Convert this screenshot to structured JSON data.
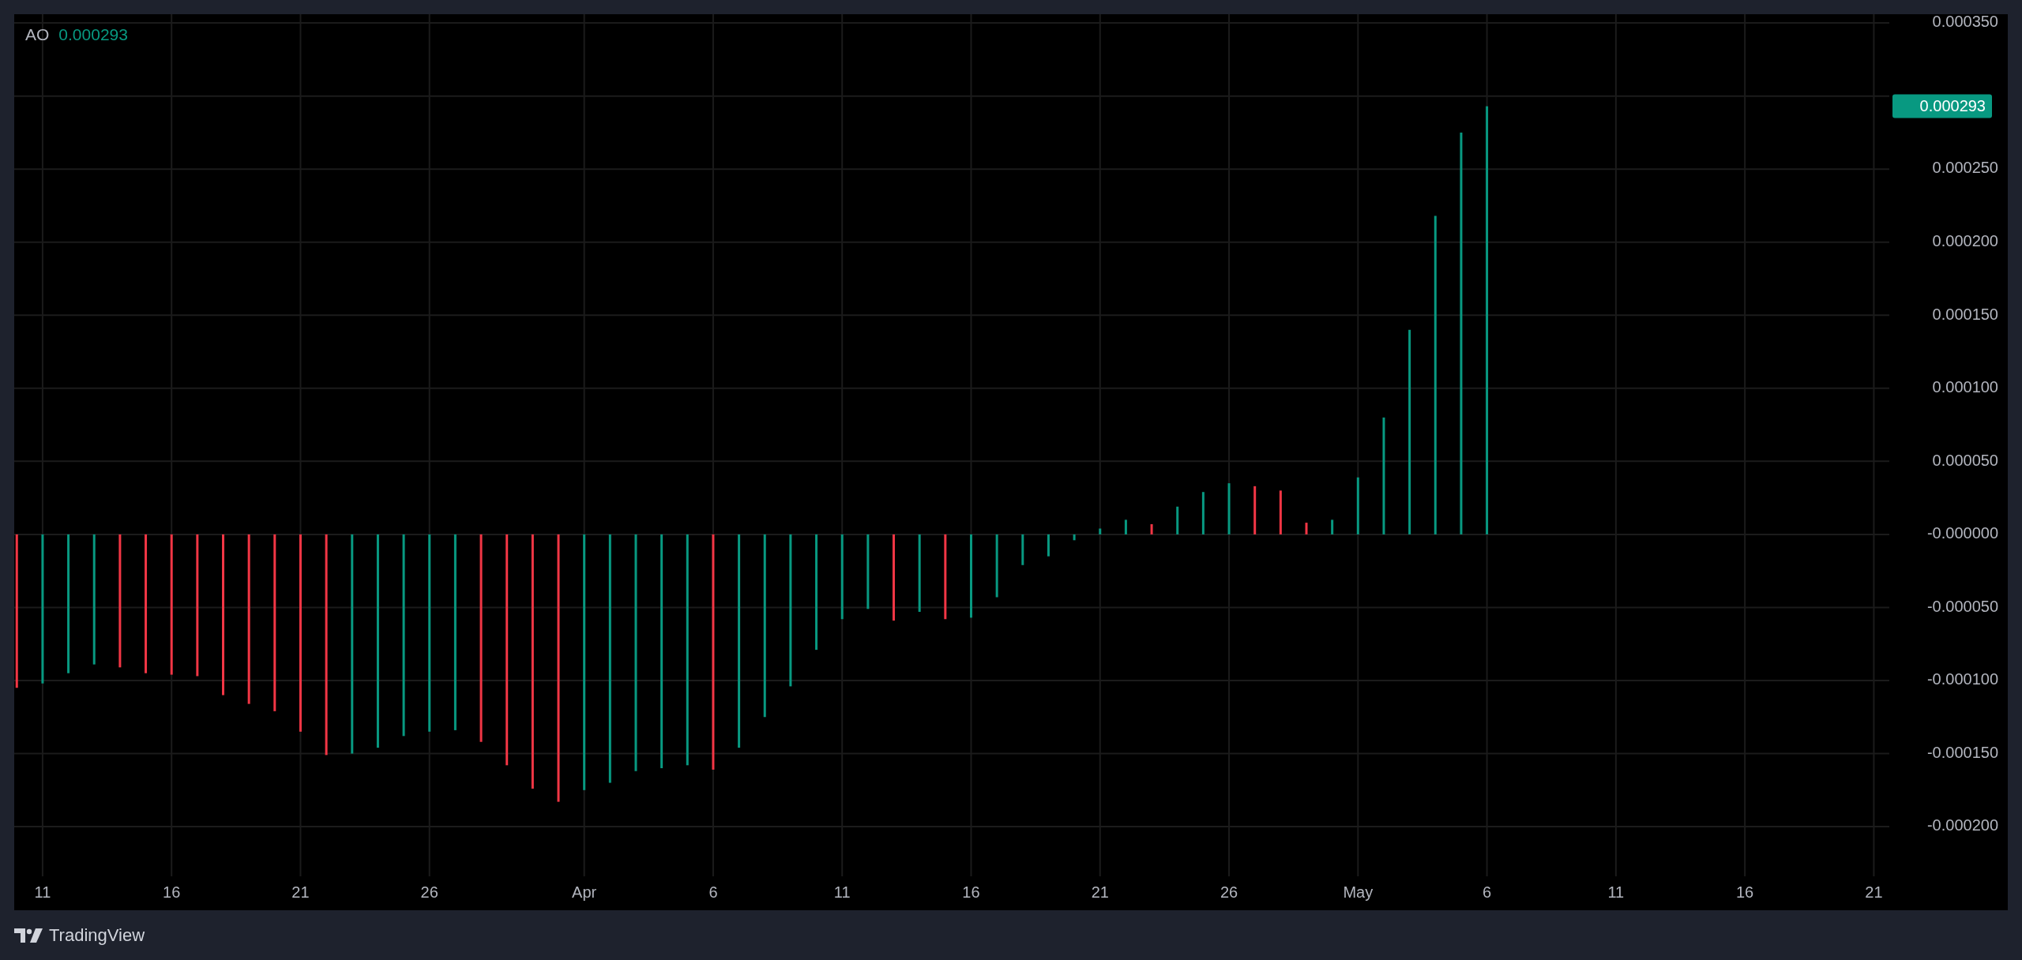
{
  "legend": {
    "name": "AO",
    "value": "0.000293"
  },
  "chart": {
    "chart_data": {
      "type": "bar",
      "grid": true,
      "categories": [
        null,
        "11",
        null,
        null,
        null,
        null,
        "16",
        null,
        null,
        null,
        null,
        "21",
        null,
        null,
        null,
        null,
        "26",
        null,
        null,
        null,
        null,
        null,
        "Apr",
        null,
        null,
        null,
        null,
        "6",
        null,
        null,
        null,
        null,
        "11",
        null,
        null,
        null,
        null,
        "16",
        null,
        null,
        null,
        null,
        "21",
        null,
        null,
        null,
        null,
        "26",
        null,
        null,
        null,
        null,
        "May",
        null,
        null,
        null,
        null,
        "6",
        null,
        null,
        null,
        null,
        "11",
        null,
        null,
        null,
        null,
        "16",
        null,
        null,
        null,
        null,
        "21"
      ],
      "ylim": [
        -0.000234,
        0.000356
      ],
      "yticks": [
        {
          "value": -0.0002,
          "label": "-0.000200"
        },
        {
          "value": -0.00015,
          "label": "-0.000150"
        },
        {
          "value": -0.0001,
          "label": "-0.000100"
        },
        {
          "value": -5e-05,
          "label": "-0.000050"
        },
        {
          "value": 0,
          "label": "-0.000000"
        },
        {
          "value": 5e-05,
          "label": "0.000050"
        },
        {
          "value": 0.0001,
          "label": "0.000100"
        },
        {
          "value": 0.00015,
          "label": "0.000150"
        },
        {
          "value": 0.0002,
          "label": "0.000200"
        },
        {
          "value": 0.00025,
          "label": "0.000250"
        },
        {
          "value": 0.00035,
          "label": "0.000350"
        }
      ],
      "series": [
        {
          "color": "#089981",
          "values": [
            null,
            -0.000102,
            -9.5e-05,
            -8.9e-05,
            null,
            null,
            null,
            null,
            null,
            null,
            null,
            null,
            null,
            -0.00015,
            -0.000146,
            -0.000138,
            -0.000135,
            -0.000134,
            null,
            null,
            null,
            null,
            -0.000175,
            -0.00017,
            -0.000162,
            -0.00016,
            -0.000158,
            null,
            -0.000146,
            -0.000125,
            -0.000104,
            -7.9e-05,
            -5.8e-05,
            -5.1e-05,
            null,
            -5.3e-05,
            null,
            -5.7e-05,
            -4.3e-05,
            -2.1e-05,
            -1.5e-05,
            -4e-06,
            4e-06,
            1e-05,
            null,
            1.9e-05,
            2.9e-05,
            3.5e-05,
            null,
            null,
            null,
            1e-05,
            3.9e-05,
            8e-05,
            0.00014,
            0.000218,
            0.000275,
            0.000293,
            null,
            null,
            null,
            null,
            null,
            null,
            null,
            null,
            null,
            null,
            null,
            null,
            null,
            null,
            null
          ]
        },
        {
          "color": "#f23645",
          "values": [
            -0.000105,
            null,
            null,
            null,
            -9.1e-05,
            -9.5e-05,
            -9.6e-05,
            -9.7e-05,
            -0.00011,
            -0.000116,
            -0.000121,
            -0.000135,
            -0.000151,
            null,
            null,
            null,
            null,
            null,
            -0.000142,
            -0.000158,
            -0.000174,
            -0.000183,
            null,
            null,
            null,
            null,
            null,
            -0.000161,
            null,
            null,
            null,
            null,
            null,
            null,
            -5.9e-05,
            null,
            -5.8e-05,
            null,
            null,
            null,
            null,
            null,
            null,
            null,
            7e-06,
            null,
            null,
            null,
            3.3e-05,
            3e-05,
            8e-06,
            null,
            null,
            null,
            null,
            null,
            null,
            null,
            null,
            null,
            null,
            null,
            null,
            null,
            null,
            null,
            null,
            null,
            null,
            null,
            null,
            null,
            null
          ]
        }
      ]
    },
    "last_value": {
      "label": "0.000293"
    }
  },
  "footer": {
    "brand": "TradingView"
  }
}
